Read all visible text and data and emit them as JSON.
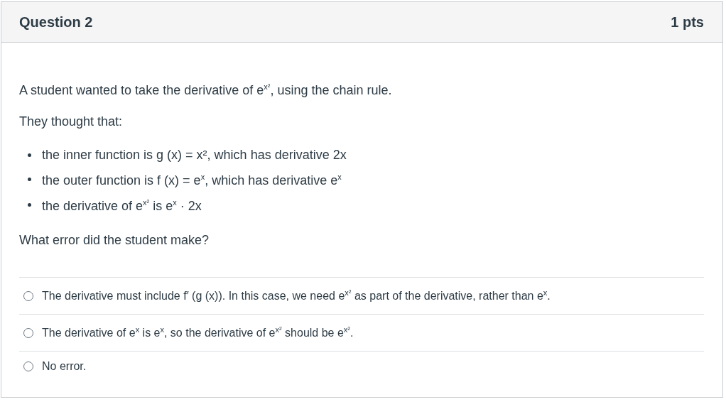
{
  "question": {
    "title": "Question 2",
    "points": "1 pts"
  },
  "prompt": "A student wanted to take the derivative of e$^{x²}$, using the chain rule.",
  "lead_in": "They thought that:",
  "bullets": [
    "the inner function is g (x) = x², which has derivative 2x",
    "the outer function is f (x) = e$^{x}$, which has derivative e$^{x}$",
    "the derivative of e$^{x²}$ is e$^{x}$ · 2x"
  ],
  "ask": "What error did the student make?",
  "answers": [
    {
      "text": "The derivative must include f′ (g (x)). In this case, we need e$^{x²}$ as part of the derivative, rather than e$^{x}$.",
      "selected": false
    },
    {
      "text": "The derivative of e$^{x}$ is e$^{x}$, so the derivative of e$^{x²}$ should be e$^{x²}$.",
      "selected": false
    },
    {
      "text": "No error.",
      "selected": false
    }
  ]
}
